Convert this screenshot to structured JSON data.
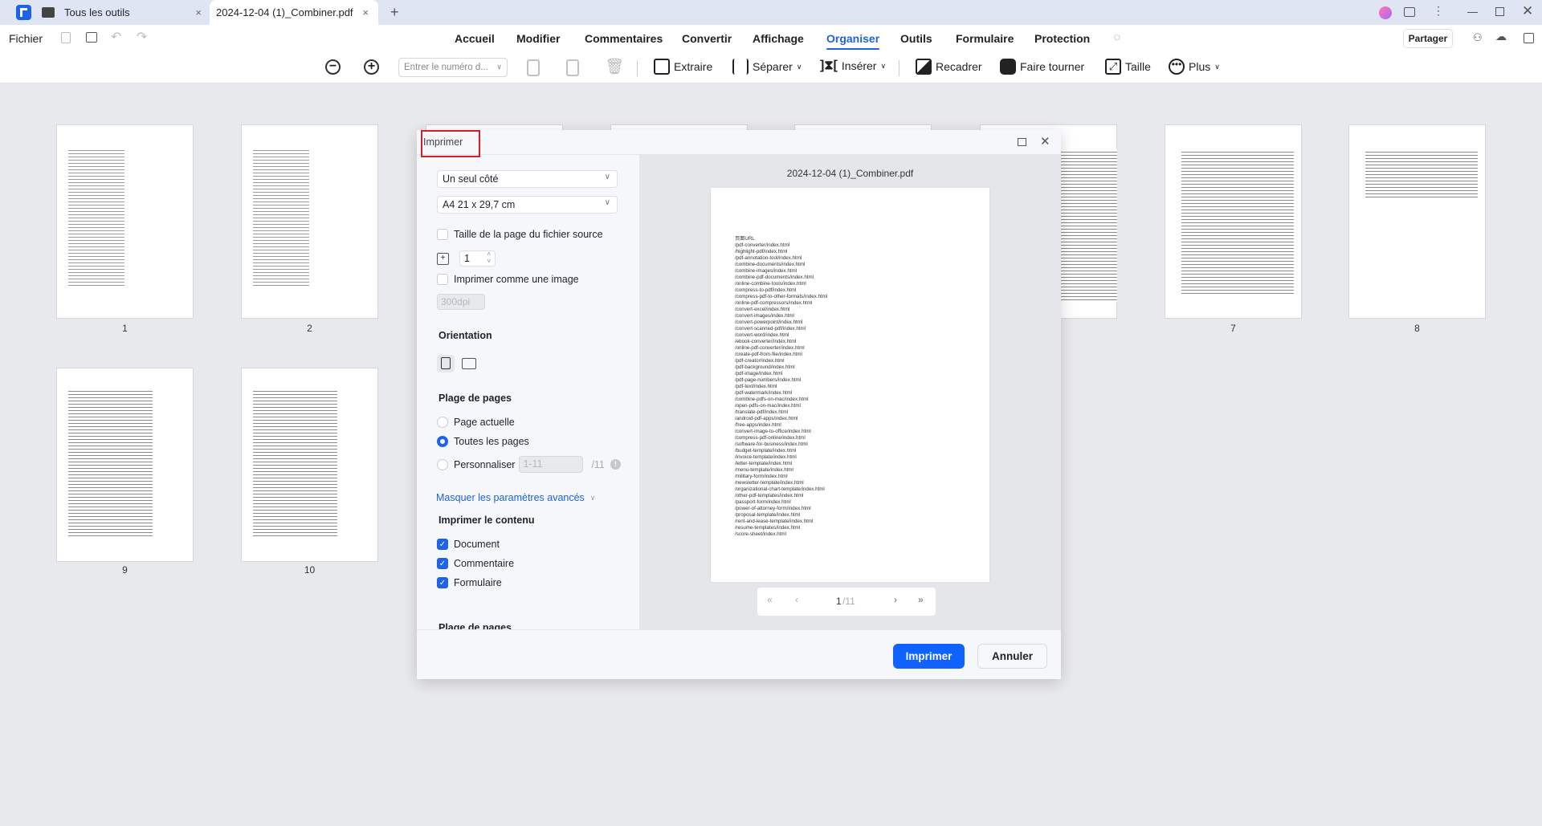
{
  "tabs": {
    "tools": "Tous les outils",
    "doc": "2024-12-04 (1)_Combiner.pdf",
    "new": "+"
  },
  "menubar": {
    "file": "Fichier",
    "items": [
      "Accueil",
      "Modifier",
      "Commentaires",
      "Convertir",
      "Affichage",
      "Organiser",
      "Outils",
      "Formulaire",
      "Protection"
    ],
    "active": "Organiser",
    "share": "Partager"
  },
  "toolbar": {
    "page_placeholder": "Entrer le numéro d...",
    "extract": "Extraire",
    "split": "Séparer",
    "insert": "Insérer",
    "crop": "Recadrer",
    "rotate": "Faire tourner",
    "size": "Taille",
    "more": "Plus"
  },
  "thumbnails": [
    "1",
    "2",
    "7",
    "8",
    "9",
    "10"
  ],
  "dialog": {
    "title": "Imprimer",
    "duplex": "Un seul côté",
    "paper": "A4 21 x 29,7 cm",
    "source_size": "Taille de la page du fichier source",
    "copies": "1",
    "as_image": "Imprimer comme une image",
    "dpi": "300dpi",
    "orientation": "Orientation",
    "range_title": "Plage de pages",
    "range_current": "Page actuelle",
    "range_all": "Toutes les pages",
    "range_custom": "Personnaliser",
    "range_custom_value": "1-11",
    "range_total": "/11",
    "advanced": "Masquer les paramètres avancés",
    "content_title": "Imprimer le contenu",
    "content": [
      "Document",
      "Commentaire",
      "Formulaire"
    ],
    "range_title2": "Plage de pages",
    "preview_title": "2024-12-04 (1)_Combiner.pdf",
    "page_current": "1",
    "page_total": "/11",
    "print": "Imprimer",
    "cancel": "Annuler",
    "preview_lines": [
      "页面URL",
      "/pdf-converter/index.html",
      "/highlight-pdf/index.html",
      "/pdf-annotation-tool/index.html",
      "/combine-documents/index.html",
      "/combine-images/index.html",
      "/combine-pdf-documents/index.html",
      "/online-combine-tools/index.html",
      "/compress-to-pdf/index.html",
      "/compress-pdf-to-other-formats/index.html",
      "/online-pdf-compressors/index.html",
      "/convert-excel/index.html",
      "/convert-images/index.html",
      "/convert-powerpoint/index.html",
      "/convert-scanned-pdf/index.html",
      "/convert-word/index.html",
      "/ebook-converter/index.html",
      "/online-pdf-converter/index.html",
      "/create-pdf-from-file/index.html",
      "/pdf-creator/index.html",
      "/pdf-background/index.html",
      "/pdf-image/index.html",
      "/pdf-page-numbers/index.html",
      "/pdf-text/index.html",
      "/pdf-watermark/index.html",
      "/combine-pdfs-on-mac/index.html",
      "/open-pdfs-on-mac/index.html",
      "/translate-pdf/index.html",
      "/android-pdf-apps/index.html",
      "/free-apps/index.html",
      "/convert-image-to-office/index.html",
      "/compress-pdf-online/index.html",
      "/software-for-business/index.html",
      "/budget-template/index.html",
      "/invoice-template/index.html",
      "/letter-template/index.html",
      "/menu-template/index.html",
      "/military-form/index.html",
      "/newsletter-template/index.html",
      "/organizational-chart-template/index.html",
      "/other-pdf-templates/index.html",
      "/passport-form/index.html",
      "/power-of-attorney-form/index.html",
      "/proposal-template/index.html",
      "/rent-and-lease-template/index.html",
      "/resume-templates/index.html",
      "/score-sheet/index.html"
    ]
  },
  "colors": {
    "accent": "#1e62e6",
    "highlight_box": "#d0202a"
  }
}
